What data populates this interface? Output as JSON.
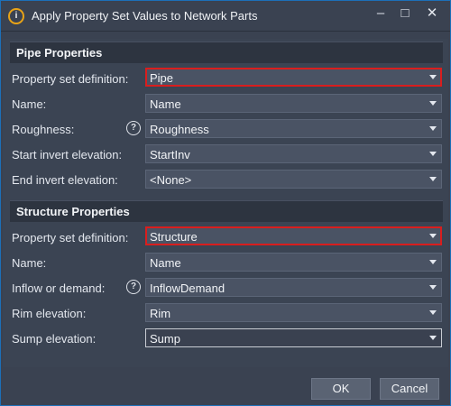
{
  "titlebar": {
    "title": "Apply Property Set Values to Network Parts",
    "minimize_label": "–",
    "maximize_label": "□",
    "close_label": "✕"
  },
  "pipe": {
    "header": "Pipe Properties",
    "rows": [
      {
        "label": "Property set definition:",
        "value": "Pipe"
      },
      {
        "label": "Name:",
        "value": "Name"
      },
      {
        "label": "Roughness:",
        "value": "Roughness"
      },
      {
        "label": "Start invert elevation:",
        "value": "StartInv"
      },
      {
        "label": "End invert elevation:",
        "value": "<None>"
      }
    ]
  },
  "structure": {
    "header": "Structure Properties",
    "rows": [
      {
        "label": "Property set definition:",
        "value": "Structure"
      },
      {
        "label": "Name:",
        "value": "Name"
      },
      {
        "label": "Inflow or demand:",
        "value": "InflowDemand"
      },
      {
        "label": "Rim elevation:",
        "value": "Rim"
      },
      {
        "label": "Sump elevation:",
        "value": "Sump"
      }
    ]
  },
  "help_glyph": "?",
  "footer": {
    "ok_label": "OK",
    "cancel_label": "Cancel"
  },
  "colors": {
    "highlight": "#d91e1e",
    "window_border": "#1c6fb8",
    "icon_accent": "#e8a317"
  }
}
